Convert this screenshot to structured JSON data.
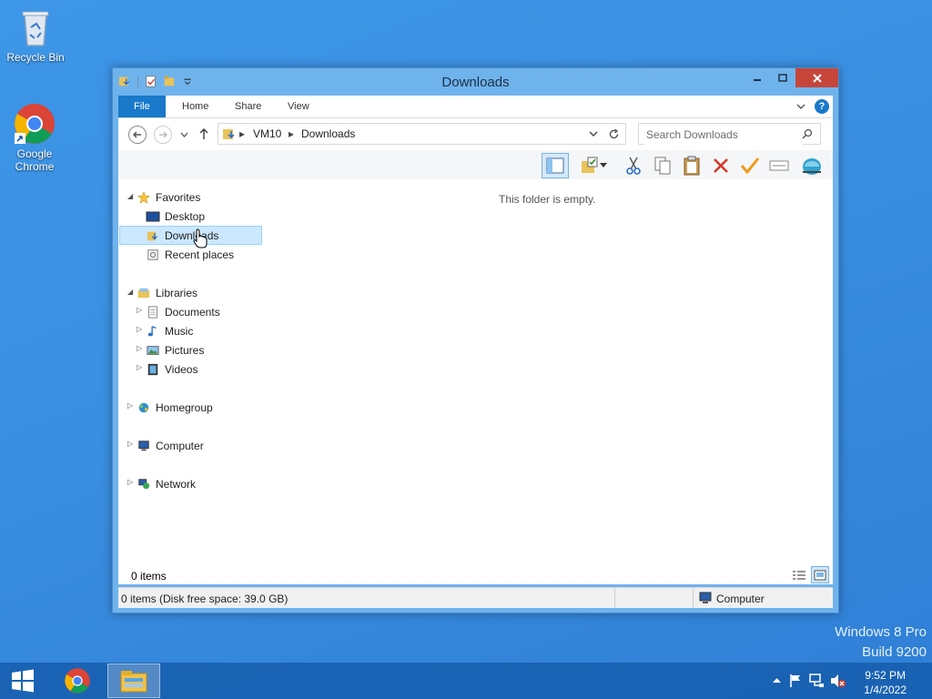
{
  "desktop": {
    "icons": [
      {
        "label": "Recycle Bin"
      },
      {
        "label": "Google Chrome"
      }
    ],
    "watermark": {
      "line1": "Windows 8 Pro",
      "line2": "Build 9200"
    }
  },
  "window": {
    "title": "Downloads",
    "ribbon": {
      "tabs": [
        "File",
        "Home",
        "Share",
        "View"
      ]
    },
    "address": {
      "segments": [
        "VM10",
        "Downloads"
      ]
    },
    "search": {
      "placeholder": "Search Downloads"
    },
    "navigation": {
      "favorites": {
        "label": "Favorites",
        "items": [
          "Desktop",
          "Downloads",
          "Recent places"
        ]
      },
      "libraries": {
        "label": "Libraries",
        "items": [
          "Documents",
          "Music",
          "Pictures",
          "Videos"
        ]
      },
      "homegroup": {
        "label": "Homegroup"
      },
      "computer": {
        "label": "Computer"
      },
      "network": {
        "label": "Network"
      }
    },
    "selected_item": "Downloads",
    "empty_message": "This folder is empty.",
    "items_count": "0 items",
    "status": {
      "left": "0 items (Disk free space: 39.0 GB)",
      "right": "Computer"
    }
  },
  "taskbar": {
    "clock": {
      "time": "9:52 PM",
      "date": "1/4/2022"
    }
  }
}
